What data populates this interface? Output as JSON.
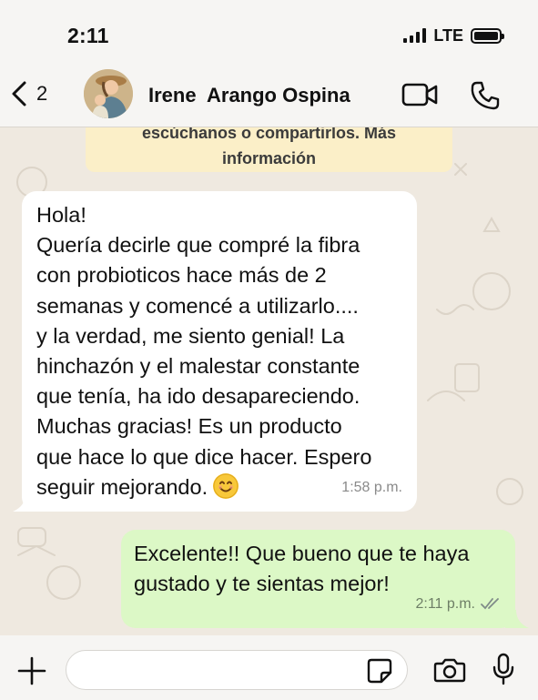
{
  "status_bar": {
    "time": "2:11",
    "network": "LTE"
  },
  "header": {
    "back_count": "2",
    "contact_name": "Irene  Arango Ospina",
    "icons": [
      "chevron-left-icon",
      "video-camera-icon",
      "phone-icon"
    ]
  },
  "notice": {
    "line1": "escúchanos o compartirlos. Más",
    "line2": "información"
  },
  "messages": [
    {
      "direction": "incoming",
      "lines": [
        "Hola!",
        "Quería decirle que compré la fibra",
        "con probioticos hace más de 2",
        "semanas y comencé a utilizarlo....",
        "y la verdad, me siento genial! La",
        "hinchazón y el malestar constante",
        "que tenía, ha ido desapareciendo.",
        "Muchas gracias! Es un producto",
        "que hace lo que dice hacer. Espero",
        "seguir mejorando."
      ],
      "emoji": "smiling-face-emoji",
      "time": "1:58 p.m."
    },
    {
      "direction": "outgoing",
      "lines": [
        "Excelente!! Que bueno que te haya",
        "gustado y te sientas mejor!"
      ],
      "time": "2:11 p.m.",
      "status": "read-double-check"
    }
  ],
  "composer": {
    "placeholder": "",
    "icons": [
      "plus-icon",
      "sticker-icon",
      "camera-icon",
      "microphone-icon"
    ]
  },
  "colors": {
    "chat_background": "#efe9e0",
    "incoming_bubble": "#ffffff",
    "outgoing_bubble": "#dcf8c6",
    "notice_background": "#fbefc8"
  }
}
